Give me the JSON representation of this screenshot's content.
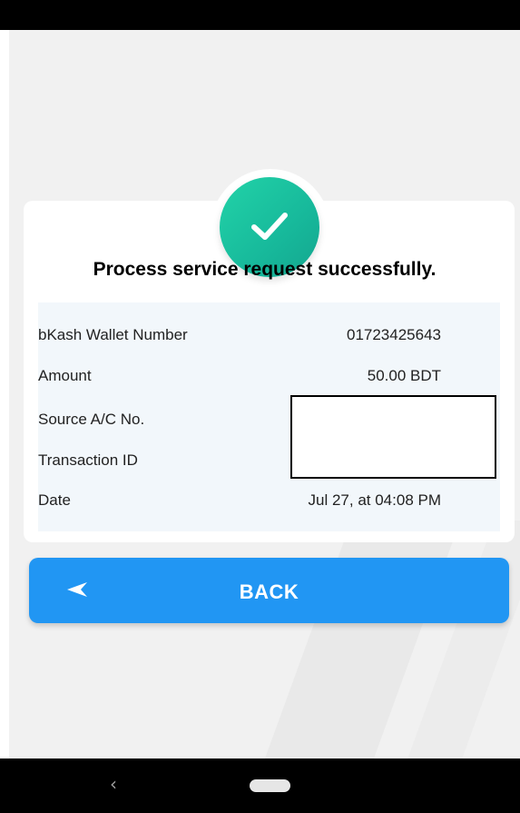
{
  "title": "Process service request successfully.",
  "details": [
    {
      "label": "bKash Wallet Number",
      "value": "01723425643"
    },
    {
      "label": "Amount",
      "value": "50.00 BDT"
    },
    {
      "label": "Source A/C No.",
      "value": ""
    },
    {
      "label": "Transaction ID",
      "value": ""
    },
    {
      "label": "Date",
      "value": "Jul 27, at 04:08 PM"
    }
  ],
  "back_button": {
    "label": "BACK",
    "icon": "arrow-left-icon"
  },
  "status_icon": "check-icon",
  "nav": {
    "back_icon": "‹",
    "home_icon": "home-pill-icon"
  },
  "colors": {
    "success": "#1ec6a0",
    "primary": "#2196f3",
    "details_bg": "#f2f7fb",
    "screen_bg": "#f1f1f1"
  }
}
